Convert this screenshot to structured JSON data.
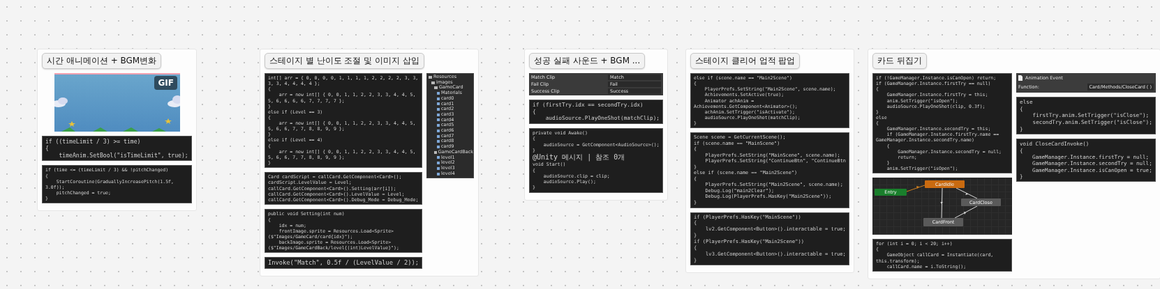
{
  "cards": [
    {
      "title": "시간 애니메이션 + BGM변화",
      "items": [
        {
          "kind": "picture",
          "badge": "GIF"
        },
        {
          "kind": "code",
          "lines": [
            "if ((timeLimit / 3) >= time)",
            "{",
            "    timeAnim.SetBool(\"isTimeLimit\", true);"
          ]
        },
        {
          "kind": "code",
          "lines": [
            "if (time <= (timeLimit / 3) && !pitchChanged)",
            "{",
            "    StartCoroutine(GraduallyIncreasePitch(1.5f, 3.0f));",
            "    pitchChanged = true;",
            "}"
          ]
        }
      ]
    },
    {
      "title": "스테이지 별 난이도 조절 및 이미지 삽입",
      "items": [
        {
          "kind": "code",
          "lines": [
            "int[] arr = { 0, 0, 0, 0, 1, 1, 1, 1, 2, 2, 2, 2, 3, 3, 3, 3, 4, 4, 4, 4 };",
            "{",
            "    arr = new int[] { 0, 0, 1, 1, 2, 2, 3, 3, 4, 4, 5, 5, 6, 6, 6, 6, 7, 7, 7, 7 };",
            "}",
            "else if (Level == 3)",
            "{",
            "    arr = new int[] { 0, 0, 1, 1, 2, 2, 3, 3, 4, 4, 5, 5, 6, 6, 7, 7, 8, 8, 9, 9 };",
            "}",
            "else if (Level == 4)",
            "{",
            "    arr = new int[] { 0, 0, 1, 1, 2, 2, 3, 3, 4, 4, 5, 5, 6, 6, 7, 7, 8, 8, 9, 9 };",
            "}"
          ]
        },
        {
          "kind": "code",
          "lines": [
            "Card cardScript = callCard.GetComponent<Card>();",
            "cardScript.LevelValue = Level;",
            "callCard.GetComponent<Card>().Setting(arr[i]);",
            "callCard.GetComponent<Card>().LevelValue = Level;",
            "callCard.GetComponent<Card>().Debug_Mode = Debug_Mode;"
          ]
        },
        {
          "kind": "code",
          "lines": [
            "public void Setting(int num)",
            "{",
            "    idx = num;",
            "    frontImage.sprite = Resources.Load<Sprite>($\"Images/GameCard/card{idx}\");",
            "    backImage.sprite = Resources.Load<Sprite>($\"Images/GameCardBack/level{(int)LevelValue}\");"
          ]
        },
        {
          "kind": "code",
          "lines": [
            "Invoke(\"Match\", 0.5f / (LevelValue / 2));"
          ]
        },
        {
          "kind": "tree",
          "nodes": [
            {
              "name": "Resources",
              "children": [
                {
                  "name": "Images",
                  "children": [
                    {
                      "name": "GameCard",
                      "children": [
                        {
                          "name": "Materials"
                        },
                        {
                          "name": "card0"
                        },
                        {
                          "name": "card1"
                        },
                        {
                          "name": "card2"
                        },
                        {
                          "name": "card3"
                        },
                        {
                          "name": "card4"
                        },
                        {
                          "name": "card5"
                        },
                        {
                          "name": "card6"
                        },
                        {
                          "name": "card7"
                        },
                        {
                          "name": "card8"
                        },
                        {
                          "name": "card9"
                        }
                      ]
                    },
                    {
                      "name": "GameCardBack",
                      "children": [
                        {
                          "name": "level1"
                        },
                        {
                          "name": "level2"
                        },
                        {
                          "name": "level3"
                        },
                        {
                          "name": "level4"
                        }
                      ]
                    }
                  ]
                }
              ]
            }
          ]
        }
      ]
    },
    {
      "title": "성공 실패 사운드 + BGM ...",
      "items": [
        {
          "kind": "inspector",
          "rows": [
            {
              "label": "Match Clip",
              "value": "Match"
            },
            {
              "label": "Fail Clip",
              "value": "Fail"
            },
            {
              "label": "Success Clip",
              "value": "Success"
            }
          ]
        },
        {
          "kind": "code",
          "lines": [
            "if (firstTry.idx == secondTry.idx)",
            "{",
            "    audioSource.PlayOneShot(matchClip);"
          ]
        },
        {
          "kind": "code",
          "lines": [
            "private void Awake()",
            "{",
            "    audioSource = GetComponent<AudioSource>();",
            "}",
            "@Unity 메시지 | 참조 0개",
            "void Start()",
            "{",
            "    audioSource.clip = clip;",
            "    audioSource.Play();",
            "}"
          ]
        }
      ]
    },
    {
      "title": "스테이지 클리어 업적 팝업",
      "items": [
        {
          "kind": "code",
          "lines": [
            "else if (scene.name == \"Main2Scene\")",
            "{",
            "    PlayerPrefs.SetString(\"Main2Scene\", scene.name);",
            "    Achievements.SetActive(true);",
            "    Animator achAnim = Achievements.GetComponent<Animator>();",
            "    achAnim.SetTrigger(\"isActivate\");",
            "    audioSource.PlayOneShot(matchClip);",
            "}"
          ]
        },
        {
          "kind": "code",
          "lines": [
            "Scene scene = GetCurrentScene();",
            "if (scene.name == \"MainScene\")",
            "{",
            "    PlayerPrefs.SetString(\"MainScene\", scene.name);",
            "    PlayerPrefs.SetString(\"ContinueBtn\", \"ContinueBtn",
            "}",
            "else if (scene.name == \"Main2Scene\")",
            "{",
            "    PlayerPrefs.SetString(\"Main2Scene\", scene.name);",
            "    Debug.Log(\"main2Clear\");",
            "    Debug.Log(PlayerPrefs.HasKey(\"Main2Scene\"));",
            "}"
          ]
        },
        {
          "kind": "code",
          "lines": [
            "if (PlayerPrefs.HasKey(\"MainScene\"))",
            "{",
            "    lv2.GetComponent<Button>().interactable = true;",
            "}",
            "if (PlayerPrefs.HasKey(\"Main2Scene\"))",
            "{",
            "    lv3.GetComponent<Button>().interactable = true;",
            "}"
          ]
        }
      ]
    },
    {
      "title": "카드 뒤집기",
      "items": [
        {
          "kind": "code",
          "lines": [
            "if (!GameManager.Instance.isCanOpen) return;",
            "if (GameManager.Instance.firstTry == null)",
            "{",
            "    GameManager.Instance.firstTry = this;",
            "    anim.SetTrigger(\"isOpen\");",
            "    audioSource.PlayOneShot(clip, 0.3f);",
            "}",
            "else",
            "{",
            "    GameManager.Instance.secondTry = this;",
            "    if (GameManager.Instance.firstTry.name == GameManager.Instance.secondTry.name)",
            "    {",
            "        GameManager.Instance.secondTry = null;",
            "        return;",
            "    }",
            "    anim.SetTrigger(\"isOpen\");"
          ]
        },
        {
          "kind": "graph",
          "nodes": [
            {
              "name": "Entry",
              "color": "#1a7f2c"
            },
            {
              "name": "CardIdle",
              "color": "#c96a10"
            },
            {
              "name": "CardClose",
              "color": "#5a5a5a"
            },
            {
              "name": "CardFront",
              "color": "#5a5a5a"
            }
          ]
        },
        {
          "kind": "code",
          "lines": [
            "for (int i = 0; i < 20; i++)",
            "{",
            "    GameObject callCard = Instantiate(card, this.transform);",
            "    callCard.name = i.ToString();"
          ]
        },
        {
          "kind": "event",
          "title": "Animation Event",
          "label": "Function:",
          "value": "Card/Methods/CloseCard ( )"
        },
        {
          "kind": "code",
          "lines": [
            "else",
            "{",
            "    firstTry.anim.SetTrigger(\"isClose\");",
            "    secondTry.anim.SetTrigger(\"isClose\");",
            "}"
          ]
        },
        {
          "kind": "code",
          "lines": [
            "void CloseCardInvoke()",
            "{",
            "    GameManager.Instance.firstTry = null;",
            "    GameManager.Instance.secondTry = null;",
            "    GameManager.Instance.isCanOpen = true;",
            "}"
          ]
        }
      ]
    }
  ]
}
